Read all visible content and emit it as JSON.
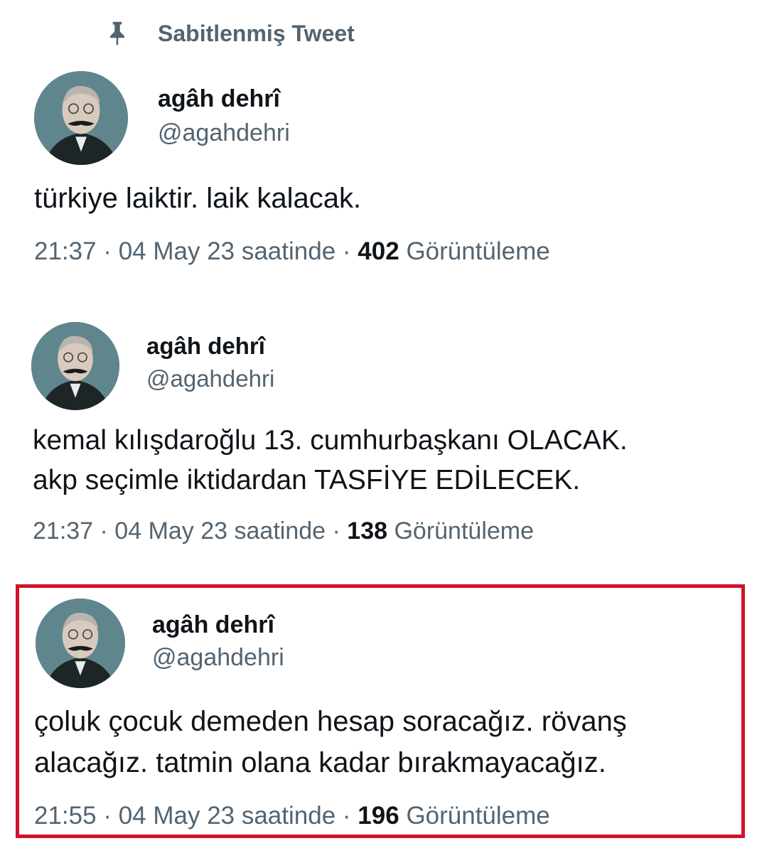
{
  "pinned": {
    "label": "Sabitlenmiş Tweet",
    "icon": "pin-icon"
  },
  "tweets": [
    {
      "name": "agâh dehrî",
      "handle": "@agahdehri",
      "text_lines": [
        "türkiye laiktir. laik kalacak."
      ],
      "time": "21:37 · 04 May 23 saatinde ·",
      "views": "402",
      "views_label": "Görüntüleme"
    },
    {
      "name": "agâh dehrî",
      "handle": "@agahdehri",
      "text_lines": [
        "kemal kılışdaroğlu 13. cumhurbaşkanı OLACAK.",
        "akp seçimle iktidardan TASFİYE EDİLECEK."
      ],
      "time": "21:37 · 04 May 23 saatinde ·",
      "views": "138",
      "views_label": "Görüntüleme"
    },
    {
      "name": "agâh dehrî",
      "handle": "@agahdehri",
      "text_lines": [
        "çoluk çocuk demeden hesap soracağız. rövanş",
        "alacağız. tatmin olana kadar bırakmayacağız."
      ],
      "time": "21:55 · 04 May 23 saatinde ·",
      "views": "196",
      "views_label": "Görüntüleme",
      "highlighted": true
    }
  ],
  "colors": {
    "highlight_border": "#d3122a",
    "secondary_text": "#536471",
    "primary_text": "#0f1419"
  }
}
